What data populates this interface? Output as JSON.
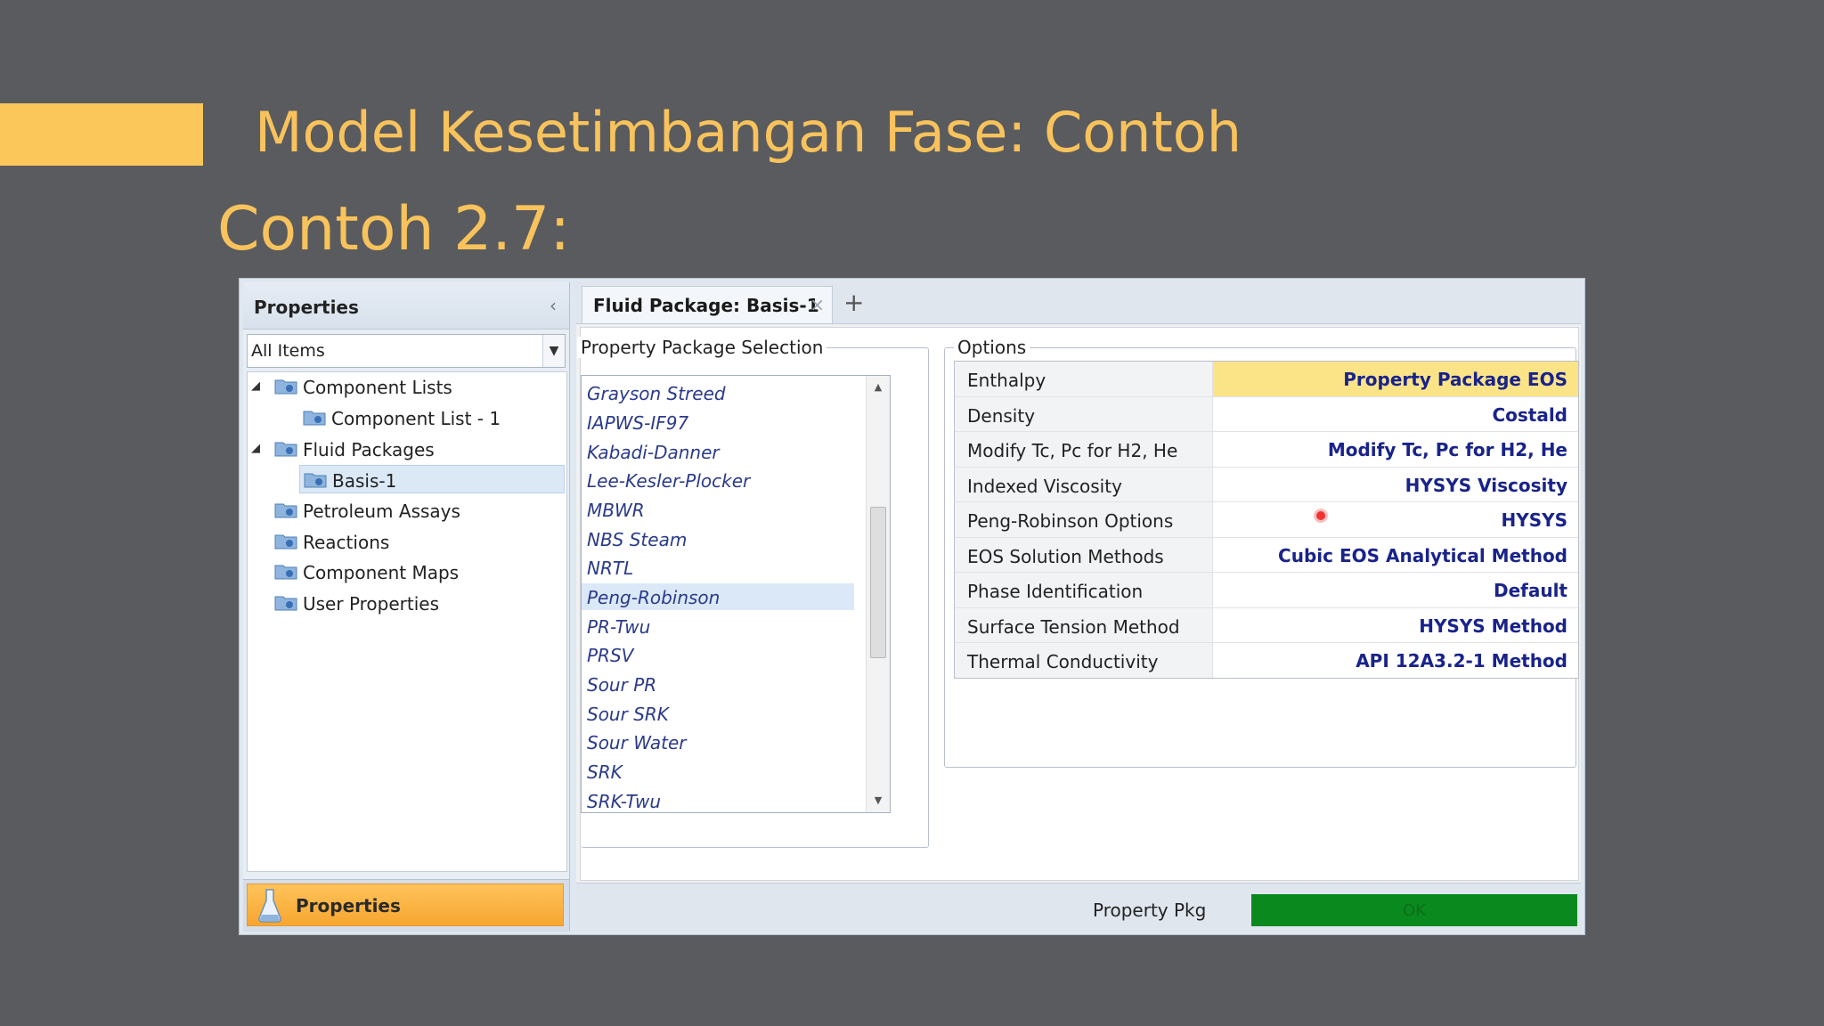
{
  "slide": {
    "title": "Model Kesetimbangan Fase: Contoh",
    "subtitle": "Contoh 2.7:",
    "accent_color": "#fbc65a",
    "title_color": "#f8c35c"
  },
  "nav": {
    "header": "Properties",
    "collapse_icon": "chevron-left-icon",
    "filter_value": "All Items",
    "tree": [
      {
        "label": "Component Lists",
        "expanded": true
      },
      {
        "label": "Component List - 1"
      },
      {
        "label": "Fluid Packages",
        "expanded": true
      },
      {
        "label": "Basis-1",
        "selected": true
      },
      {
        "label": "Petroleum Assays"
      },
      {
        "label": "Reactions"
      },
      {
        "label": "Component Maps"
      },
      {
        "label": "User Properties"
      }
    ],
    "bottom_button": "Properties"
  },
  "tab": {
    "label": "Fluid Package: Basis-1",
    "close_glyph": "×",
    "add_glyph": "+"
  },
  "package_selection": {
    "title": "Property Package Selection",
    "items": [
      "Grayson Streed",
      "IAPWS-IF97",
      "Kabadi-Danner",
      "Lee-Kesler-Plocker",
      "MBWR",
      "NBS Steam",
      "NRTL",
      "Peng-Robinson",
      "PR-Twu",
      "PRSV",
      "Sour PR",
      "Sour SRK",
      "Sour Water",
      "SRK",
      "SRK-Twu"
    ],
    "selected": "Peng-Robinson",
    "scroll_position": 0.45
  },
  "options": {
    "title": "Options",
    "rows": [
      {
        "name": "Enthalpy",
        "value": "Property Package EOS",
        "highlight": true
      },
      {
        "name": "Density",
        "value": "Costald"
      },
      {
        "name": "Modify Tc, Pc for H2, He",
        "value": "Modify Tc, Pc for H2, He"
      },
      {
        "name": "Indexed Viscosity",
        "value": "HYSYS Viscosity"
      },
      {
        "name": "Peng-Robinson Options",
        "value": "HYSYS"
      },
      {
        "name": "EOS Solution Methods",
        "value": "Cubic EOS Analytical Method"
      },
      {
        "name": "Phase Identification",
        "value": "Default"
      },
      {
        "name": "Surface Tension Method",
        "value": "HYSYS Method"
      },
      {
        "name": "Thermal Conductivity",
        "value": "API 12A3.2-1 Method"
      }
    ]
  },
  "status": {
    "label": "Property Pkg",
    "state": "OK",
    "color": "#0a8a1e"
  }
}
